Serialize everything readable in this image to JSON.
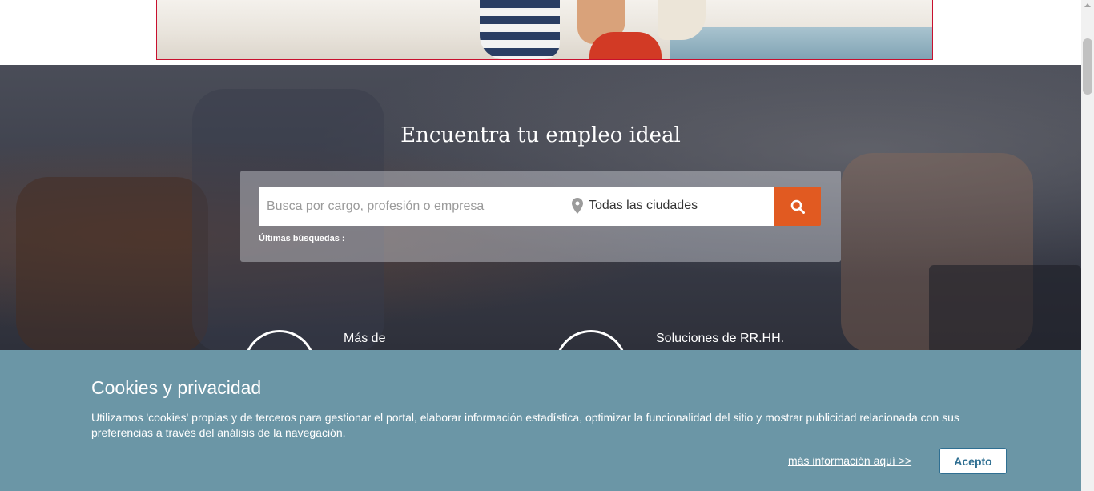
{
  "hero": {
    "title": "Encuentra tu empleo ideal",
    "search_placeholder": "Busca por cargo, profesión o empresa",
    "city_value": "Todas las ciudades",
    "recent_searches_label": "Últimas búsquedas :",
    "search_button_icon": "search-icon",
    "location_icon": "map-pin-icon"
  },
  "features": [
    {
      "label": "Más de"
    },
    {
      "label": "Soluciones de RR.HH."
    }
  ],
  "cookie": {
    "title": "Cookies y privacidad",
    "body": "Utilizamos 'cookies' propias y de terceros para gestionar el portal, elaborar información estadística, optimizar la funcionalidad del sitio y mostrar publicidad relacionada con sus preferencias a través del análisis de la navegación.",
    "more_info_link": "más información aquí >>",
    "accept_button": "Acepto"
  },
  "colors": {
    "accent": "#e15a21",
    "cookie_background": "#6b96a6",
    "banner_border": "#c8102e",
    "accept_text": "#2f6f92"
  }
}
